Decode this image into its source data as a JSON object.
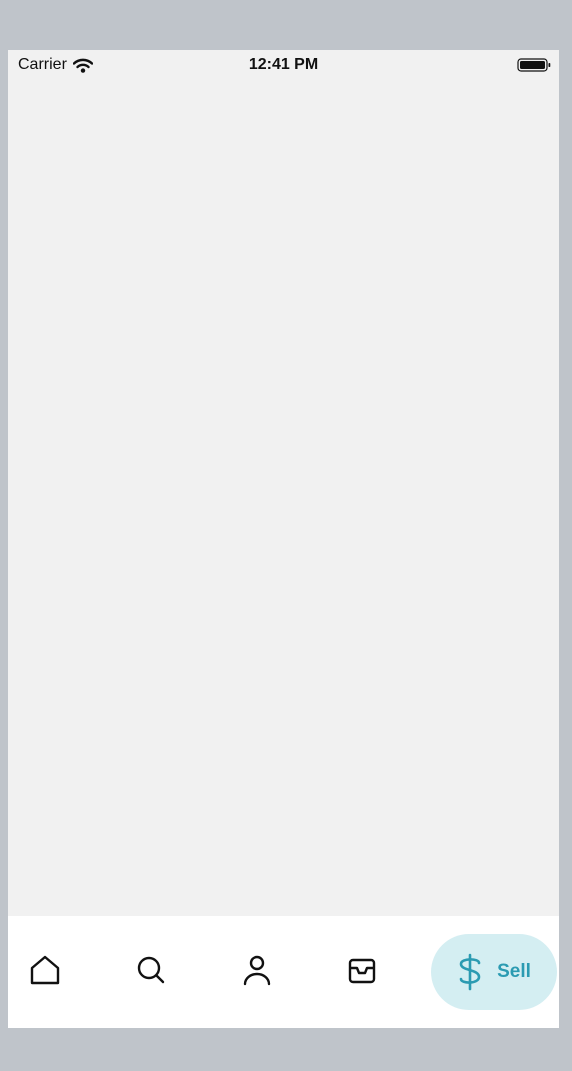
{
  "status_bar": {
    "carrier": "Carrier",
    "time": "12:41 PM"
  },
  "tab_bar": {
    "items": [
      {
        "name": "home",
        "icon": "home-icon"
      },
      {
        "name": "search",
        "icon": "search-icon"
      },
      {
        "name": "profile",
        "icon": "person-icon"
      },
      {
        "name": "inbox",
        "icon": "inbox-icon"
      }
    ],
    "sell": {
      "label": "Sell",
      "icon": "dollar-icon"
    }
  },
  "colors": {
    "accent": "#2b9bb2",
    "accent_bg": "#d4eef2",
    "content_bg": "#f1f1f1",
    "outer_bg": "#bfc4ca"
  }
}
